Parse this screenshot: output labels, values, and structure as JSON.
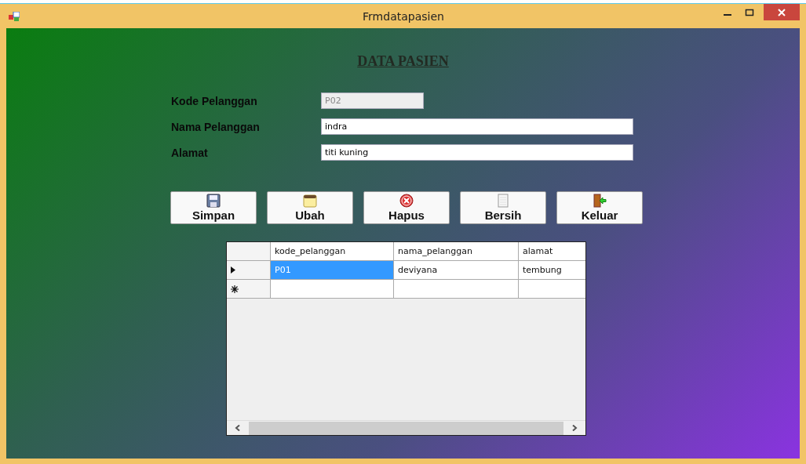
{
  "window": {
    "title": "Frmdatapasien"
  },
  "heading": "DATA PASIEN",
  "fields": [
    {
      "label": "Kode Pelanggan",
      "value": "P02",
      "disabled": true,
      "wide": false
    },
    {
      "label": "Nama Pelanggan",
      "value": "indra",
      "disabled": false,
      "wide": true
    },
    {
      "label": "Alamat",
      "value": "titi kuning",
      "disabled": false,
      "wide": true
    }
  ],
  "buttons": [
    {
      "label": "Simpan",
      "kind": "save"
    },
    {
      "label": "Ubah",
      "kind": "edit"
    },
    {
      "label": "Hapus",
      "kind": "delete"
    },
    {
      "label": "Bersih",
      "kind": "clear"
    },
    {
      "label": "Keluar",
      "kind": "exit"
    }
  ],
  "grid": {
    "columns": [
      "kode_pelanggan",
      "nama_pelanggan",
      "alamat"
    ],
    "rows": [
      {
        "kind": "current",
        "cells": [
          {
            "text": "P01",
            "selected": true
          },
          {
            "text": "deviyana",
            "selected": false
          },
          {
            "text": "tembung",
            "selected": false
          }
        ]
      },
      {
        "kind": "new",
        "cells": []
      }
    ]
  }
}
